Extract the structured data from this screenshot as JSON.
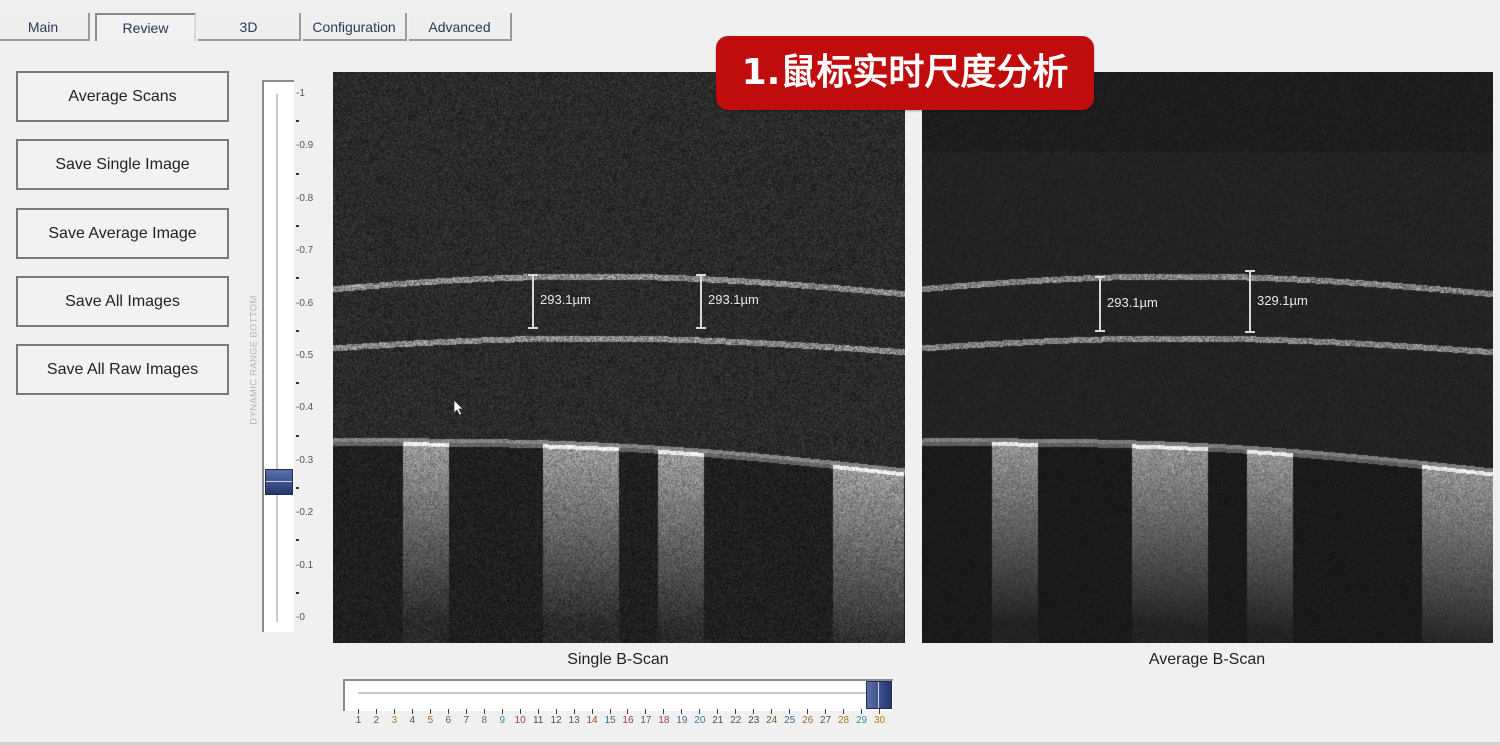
{
  "tabs": [
    {
      "label": "Main",
      "active": false
    },
    {
      "label": "Review",
      "active": true
    },
    {
      "label": "3D",
      "active": false
    },
    {
      "label": "Configuration",
      "active": false
    },
    {
      "label": "Advanced",
      "active": false
    }
  ],
  "actions": {
    "average_scans": "Average Scans",
    "save_single_image": "Save Single Image",
    "save_average_image": "Save Average Image",
    "save_all_images": "Save All Images",
    "save_all_raw_images": "Save All Raw Images"
  },
  "dynamic_range": {
    "label": "DYNAMIC RANGE BOTTOM",
    "min": 0,
    "max": 1,
    "value": 0.26,
    "tick_labels": [
      "1",
      "0.9",
      "0.8",
      "0.7",
      "0.6",
      "0.5",
      "0.4",
      "0.3",
      "0.2",
      "0.1",
      "0"
    ]
  },
  "banner": {
    "text": "1.鼠标实时尺度分析",
    "color": "#c00c0c"
  },
  "single_scan": {
    "caption": "Single B-Scan",
    "measurements": [
      "293.1µm",
      "293.1µm"
    ]
  },
  "average_scan": {
    "caption": "Average B-Scan",
    "measurements": [
      "293.1µm",
      "329.1µm"
    ]
  },
  "frame_slider": {
    "min": 1,
    "max": 30,
    "value": 30,
    "tick_labels": [
      "1",
      "2",
      "3",
      "4",
      "5",
      "6",
      "7",
      "8",
      "9",
      "10",
      "11",
      "12",
      "13",
      "14",
      "15",
      "16",
      "17",
      "18",
      "19",
      "20",
      "21",
      "22",
      "23",
      "24",
      "25",
      "26",
      "27",
      "28",
      "29",
      "30"
    ]
  },
  "colors": {
    "slider_thumb": "#2e4080",
    "background": "#f0f0f0",
    "tab_text": "#2b3a55"
  }
}
